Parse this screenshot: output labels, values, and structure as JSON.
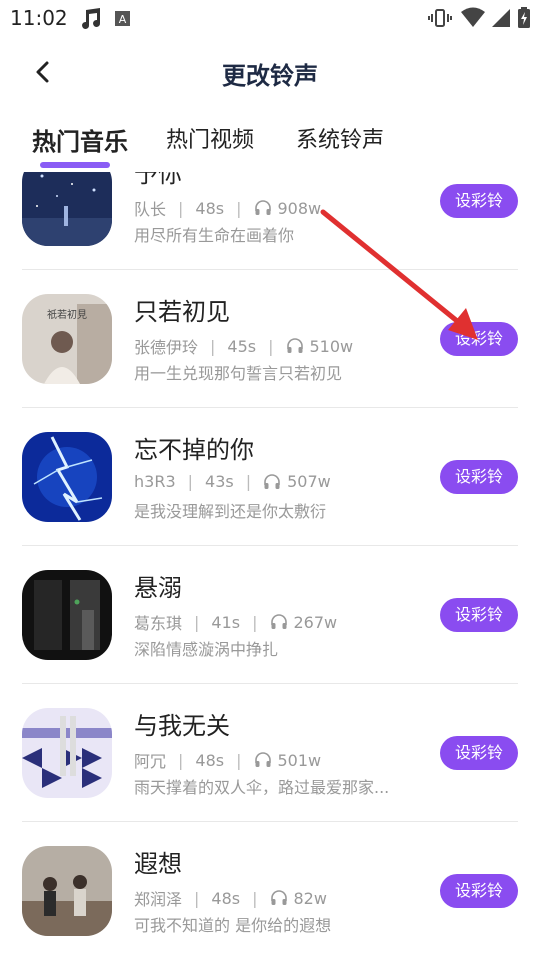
{
  "status_bar": {
    "time": "11:02",
    "left_icons": [
      "music-note-icon",
      "app-a-icon"
    ],
    "right_icons": [
      "vibrate-icon",
      "wifi-icon",
      "signal-icon",
      "battery-charging-icon"
    ]
  },
  "header": {
    "title": "更改铃声",
    "back_icon": "back-chevron-icon"
  },
  "tabs": [
    {
      "label": "热门音乐",
      "active": true
    },
    {
      "label": "热门视频",
      "active": false
    },
    {
      "label": "系统铃声",
      "active": false
    }
  ],
  "accent_color": "#8a4cf0",
  "songs": [
    {
      "title": "予你",
      "artist": "队长",
      "duration": "48s",
      "plays": "908w",
      "desc": "用尽所有生命在画着你",
      "button": "设彩铃",
      "cover_icon": "cover-night-sky"
    },
    {
      "title": "只若初见",
      "artist": "张德伊玲",
      "duration": "45s",
      "plays": "510w",
      "desc": "用一生兑现那句誓言只若初见",
      "button": "设彩铃",
      "cover_icon": "cover-girl-portrait"
    },
    {
      "title": "忘不掉的你",
      "artist": "h3R3",
      "duration": "43s",
      "plays": "507w",
      "desc": "是我没理解到还是你太敷衍",
      "button": "设彩铃",
      "cover_icon": "cover-lightning"
    },
    {
      "title": "悬溺",
      "artist": "葛东琪",
      "duration": "41s",
      "plays": "267w",
      "desc": "深陷情感漩涡中挣扎",
      "button": "设彩铃",
      "cover_icon": "cover-dark-room"
    },
    {
      "title": "与我无关",
      "artist": "阿冗",
      "duration": "48s",
      "plays": "501w",
      "desc": "雨天撑着的双人伞，路过最爱那家...",
      "button": "设彩铃",
      "cover_icon": "cover-checkered"
    },
    {
      "title": "遐想",
      "artist": "郑润泽",
      "duration": "48s",
      "plays": "82w",
      "desc": "可我不知道的 是你给的遐想",
      "button": "设彩铃",
      "cover_icon": "cover-group-photo"
    }
  ]
}
